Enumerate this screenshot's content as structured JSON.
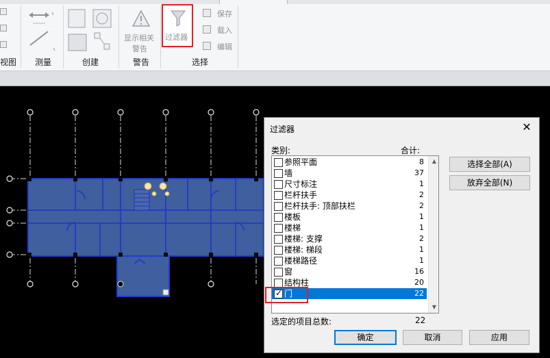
{
  "ribbon": {
    "panels": [
      {
        "label": "视图"
      },
      {
        "label": "测量"
      },
      {
        "label": "创建"
      },
      {
        "label": "警告"
      },
      {
        "label": "选择"
      }
    ],
    "buttons": {
      "show_warnings_line1": "显示相关",
      "show_warnings_line2": "警告",
      "filter": "过滤器",
      "save": "保存",
      "load": "载入",
      "edit": "编辑"
    }
  },
  "dialog": {
    "title": "过滤器",
    "category_header": "类别:",
    "total_header": "合计:",
    "items": [
      {
        "name": "参照平面",
        "count": "8",
        "checked": false
      },
      {
        "name": "墙",
        "count": "37",
        "checked": false
      },
      {
        "name": "尺寸标注",
        "count": "1",
        "checked": false
      },
      {
        "name": "栏杆扶手",
        "count": "2",
        "checked": false
      },
      {
        "name": "栏杆扶手: 顶部扶栏",
        "count": "2",
        "checked": false
      },
      {
        "name": "楼板",
        "count": "1",
        "checked": false
      },
      {
        "name": "楼梯",
        "count": "1",
        "checked": false
      },
      {
        "name": "楼梯: 支撑",
        "count": "2",
        "checked": false
      },
      {
        "name": "楼梯: 梯段",
        "count": "1",
        "checked": false
      },
      {
        "name": "楼梯路径",
        "count": "1",
        "checked": false
      },
      {
        "name": "窗",
        "count": "16",
        "checked": false
      },
      {
        "name": "结构柱",
        "count": "20",
        "checked": false
      },
      {
        "name": "门",
        "count": "22",
        "checked": true
      }
    ],
    "select_all": "选择全部(A)",
    "check_none": "放弃全部(N)",
    "total_selected_label": "选定的项目总数:",
    "total_selected_value": "22",
    "ok": "确定",
    "cancel": "取消",
    "apply": "应用"
  },
  "colors": {
    "selection": "#0078d7",
    "highlight_box": "#e0202a",
    "floor_plan_fill": "#3f5f9e",
    "canvas_bg": "#000000"
  }
}
